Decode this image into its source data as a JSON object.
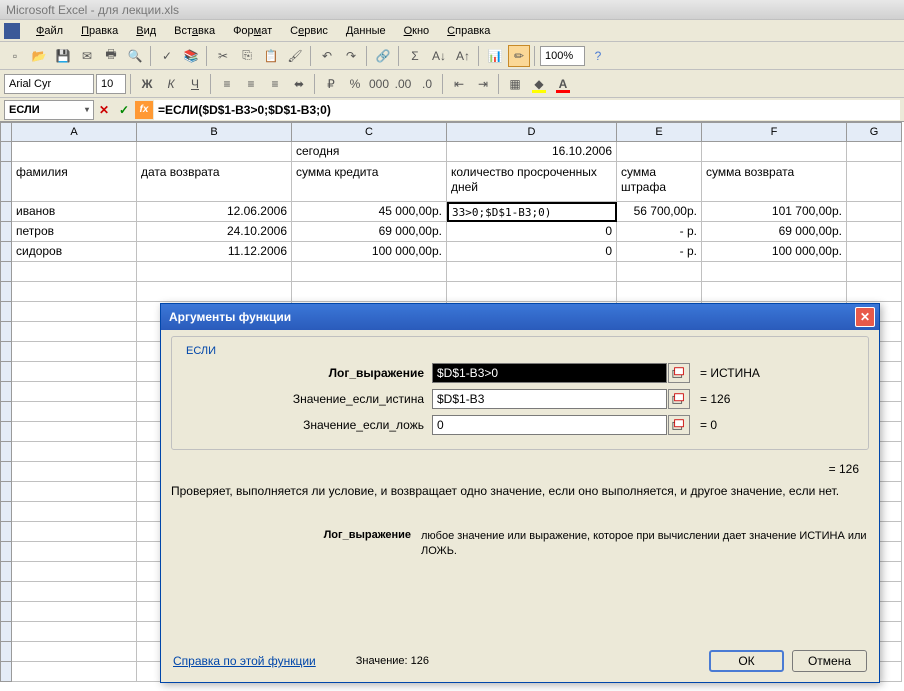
{
  "title": "Microsoft Excel - для лекции.xls",
  "menu": [
    "Файл",
    "Правка",
    "Вид",
    "Вставка",
    "Формат",
    "Сервис",
    "Данные",
    "Окно",
    "Справка"
  ],
  "font": "Arial Cyr",
  "font_size": "10",
  "zoom": "100%",
  "name_box": "ЕСЛИ",
  "formula": "=ЕСЛИ($D$1-B3>0;$D$1-B3;0)",
  "cols": [
    "A",
    "B",
    "C",
    "D",
    "E",
    "F",
    "G"
  ],
  "grid": {
    "r1": {
      "C": "сегодня",
      "D": "16.10.2006"
    },
    "r2": {
      "A": "фамилия",
      "B": "дата возврата",
      "C": "сумма кредита",
      "D": "количество просроченных дней",
      "E": "сумма штрафа",
      "F": "сумма возврата"
    },
    "r3": {
      "A": "иванов",
      "B": "12.06.2006",
      "C": "45 000,00р.",
      "D": "33>0;$D$1-B3;0)",
      "E": "56 700,00р.",
      "F": "101 700,00р."
    },
    "r4": {
      "A": "петров",
      "B": "24.10.2006",
      "C": "69 000,00р.",
      "D": "0",
      "E": "-   р.",
      "F": "69 000,00р."
    },
    "r5": {
      "A": "сидоров",
      "B": "11.12.2006",
      "C": "100 000,00р.",
      "D": "0",
      "E": "-   р.",
      "F": "100 000,00р."
    }
  },
  "dialog": {
    "title": "Аргументы функции",
    "fn": "ЕСЛИ",
    "args": [
      {
        "label": "Лог_выражение",
        "value": "$D$1-B3>0",
        "result": "= ИСТИНА",
        "bold": true,
        "dark": true
      },
      {
        "label": "Значение_если_истина",
        "value": "$D$1-B3",
        "result": "= 126"
      },
      {
        "label": "Значение_если_ложь",
        "value": "0",
        "result": "= 0"
      }
    ],
    "big_result": "= 126",
    "desc": "Проверяет, выполняется ли условие, и возвращает одно значение, если оно выполняется, и другое значение, если нет.",
    "arg_name": "Лог_выражение",
    "arg_desc": "любое значение или выражение, которое при вычислении дает значение ИСТИНА или ЛОЖЬ.",
    "help": "Справка по этой функции",
    "value_label": "Значение:",
    "value": "126",
    "ok": "ОК",
    "cancel": "Отмена"
  }
}
